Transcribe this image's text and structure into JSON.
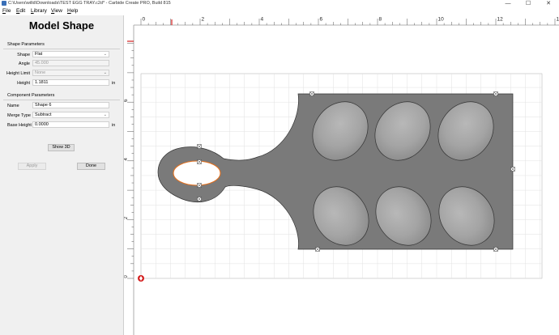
{
  "window": {
    "title": "C:\\Users\\willd\\Downloads\\TEST EGG TRAY.c2d* - Carbide Create PRO, Build 815",
    "controls": [
      "—",
      "☐",
      "✕"
    ]
  },
  "menu": [
    {
      "label": "File",
      "key": "F",
      "rest": "ile"
    },
    {
      "label": "Edit",
      "key": "E",
      "rest": "dit"
    },
    {
      "label": "Library",
      "key": "L",
      "rest": "ibrary"
    },
    {
      "label": "View",
      "key": "V",
      "rest": "iew"
    },
    {
      "label": "Help",
      "key": "H",
      "rest": "elp"
    }
  ],
  "panel": {
    "title": "Model Shape",
    "shape_params": {
      "heading": "Shape Parameters",
      "shape_label": "Shape",
      "shape_value": "Flat",
      "angle_label": "Angle",
      "angle_value": "45.000",
      "height_limit_label": "Height Limit",
      "height_limit_value": "None",
      "height_label": "Height",
      "height_value": "1.1811",
      "height_unit": "in"
    },
    "component_params": {
      "heading": "Component Parameters",
      "name_label": "Name",
      "name_value": "Shape 6",
      "merge_label": "Merge Type",
      "merge_value": "Subtract",
      "base_height_label": "Base Height",
      "base_height_value": "0.0000",
      "base_height_unit": "in"
    },
    "show3d_label": "Show 3D",
    "apply_label": "Apply",
    "done_label": "Done"
  },
  "ruler": {
    "top_labels": [
      "0",
      "2",
      "4",
      "6",
      "8",
      "10",
      "12",
      "14"
    ],
    "left_labels": [
      "6",
      "4",
      "2",
      "0"
    ]
  },
  "colors": {
    "shape_fill": "#7a7a7a",
    "shape_stroke": "#333333",
    "selection": "#e07020",
    "origin": "#d42020",
    "grid": "#dddddd"
  }
}
